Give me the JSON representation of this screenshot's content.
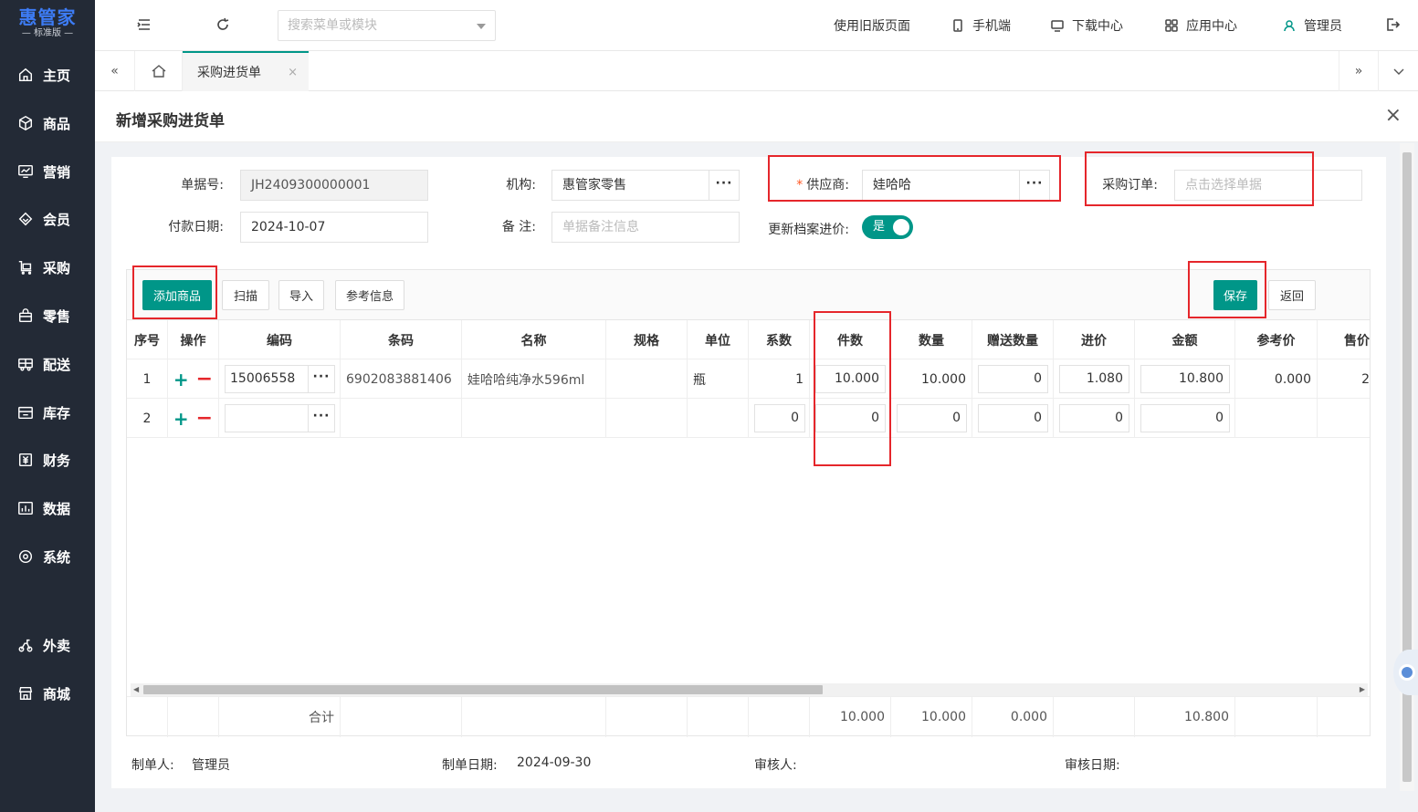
{
  "brand": {
    "name": "惠管家",
    "edition": "标准版"
  },
  "sidebar": {
    "items": [
      {
        "label": "主页",
        "icon": "home-icon"
      },
      {
        "label": "商品",
        "icon": "box-icon"
      },
      {
        "label": "营销",
        "icon": "monitor-chart-icon"
      },
      {
        "label": "会员",
        "icon": "diamond-icon"
      },
      {
        "label": "采购",
        "icon": "cart-icon"
      },
      {
        "label": "零售",
        "icon": "shopping-bag-icon"
      },
      {
        "label": "配送",
        "icon": "truck-icon"
      },
      {
        "label": "库存",
        "icon": "warehouse-icon"
      },
      {
        "label": "财务",
        "icon": "currency-icon"
      },
      {
        "label": "数据",
        "icon": "bar-chart-icon"
      },
      {
        "label": "系统",
        "icon": "settings-icon"
      },
      {
        "label": "外卖",
        "icon": "scooter-icon"
      },
      {
        "label": "商城",
        "icon": "store-icon"
      }
    ]
  },
  "topbar": {
    "search_placeholder": "搜索菜单或模块",
    "old_page": "使用旧版页面",
    "mobile": "手机端",
    "download": "下载中心",
    "apps": "应用中心",
    "user": "管理员"
  },
  "tabs": {
    "active": "采购进货单",
    "close": "×"
  },
  "page": {
    "title": "新增采购进货单",
    "close": "×"
  },
  "form": {
    "doc_no_label": "单据号:",
    "doc_no": "JH2409300000001",
    "org_label": "机构:",
    "org": "惠管家零售",
    "supplier_label": "供应商:",
    "supplier": "娃哈哈",
    "po_label": "采购订单:",
    "po_placeholder": "点击选择单据",
    "pay_date_label": "付款日期:",
    "pay_date": "2024-10-07",
    "remark_label": "备 注:",
    "remark_placeholder": "单据备注信息",
    "update_price_label": "更新档案进价:",
    "update_price_toggle": "是",
    "dots": "···"
  },
  "toolbar": {
    "add": "添加商品",
    "scan": "扫描",
    "import": "导入",
    "reference": "参考信息",
    "save": "保存",
    "back": "返回"
  },
  "table": {
    "headers": [
      "序号",
      "操作",
      "编码",
      "条码",
      "名称",
      "规格",
      "单位",
      "系数",
      "件数",
      "数量",
      "赠送数量",
      "进价",
      "金额",
      "参考价",
      "售价"
    ],
    "rows": [
      {
        "seq": "1",
        "plus": "+",
        "minus": "−",
        "code": "15006558",
        "barcode": "6902083881406",
        "name": "娃哈哈纯净水596ml",
        "spec": "",
        "unit": "瓶",
        "factor": "1",
        "pieces": "10.000",
        "qty": "10.000",
        "gift": "0",
        "price": "1.080",
        "amount": "10.800",
        "ref_price": "0.000",
        "sale_price": "2"
      },
      {
        "seq": "2",
        "plus": "+",
        "minus": "−",
        "code": "",
        "barcode": "",
        "name": "",
        "spec": "",
        "unit": "",
        "factor": "0",
        "pieces": "0",
        "qty": "0",
        "gift": "0",
        "price": "0",
        "amount": "0",
        "ref_price": "",
        "sale_price": ""
      }
    ],
    "footer": {
      "label": "合计",
      "pieces": "10.000",
      "qty": "10.000",
      "gift": "0.000",
      "amount": "10.800"
    }
  },
  "meta": {
    "maker_label": "制单人:",
    "maker": "管理员",
    "make_date_label": "制单日期:",
    "make_date": "2024-09-30",
    "auditor_label": "审核人:",
    "audit_date_label": "审核日期:"
  },
  "colors": {
    "primary": "#009688",
    "sidebar": "#232a36",
    "highlight": "#e5262b",
    "danger": "#e5262b",
    "brand": "#3d7cf5"
  }
}
